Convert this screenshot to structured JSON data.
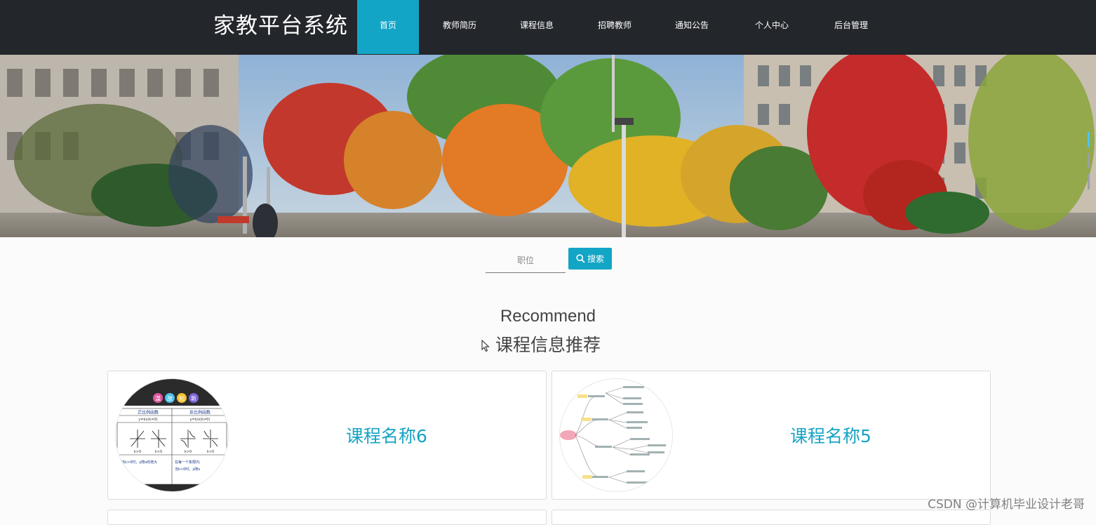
{
  "header": {
    "brand": "家教平台系统",
    "nav": [
      {
        "label": "首页",
        "active": true
      },
      {
        "label": "教师简历"
      },
      {
        "label": "课程信息"
      },
      {
        "label": "招聘教师"
      },
      {
        "label": "通知公告"
      },
      {
        "label": "个人中心"
      },
      {
        "label": "后台管理"
      }
    ],
    "accent_color": "#12a5c6",
    "bar_color": "#23262b"
  },
  "search": {
    "placeholder": "职位",
    "button_label": "搜索",
    "button_icon": "search-icon"
  },
  "section": {
    "title_en": "Recommend",
    "title_zh": "课程信息推荐"
  },
  "cards": [
    {
      "title": "课程名称6",
      "thumb": {
        "badges": [
          "温",
          "故",
          "知",
          "新"
        ],
        "col1": "正比例函数",
        "col2": "反比例函数",
        "f1": "y=kx(k≠0)",
        "f2": "y=k/x(k≠0)",
        "k1": "k>0",
        "k2": "k<0",
        "k3": "k>0",
        "k4": "k<0",
        "note1": "当k>0时，y随x的增大",
        "note2": "在每一个象限内:",
        "note3": "当k<0时，y随x"
      }
    },
    {
      "title": "课程名称5",
      "thumb": {
        "kind": "mindmap"
      }
    }
  ],
  "watermark": "CSDN @计算机毕业设计老哥"
}
